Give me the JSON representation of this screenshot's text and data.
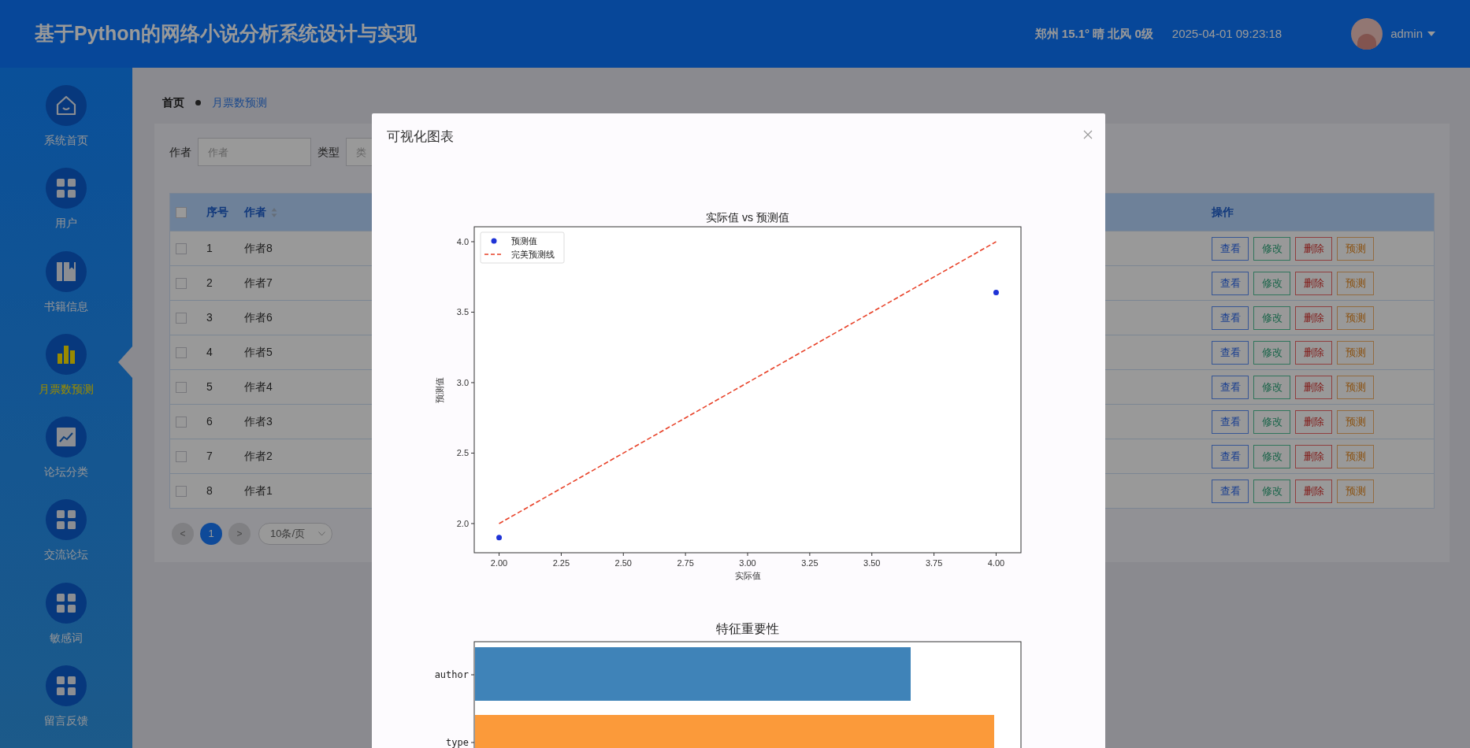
{
  "header": {
    "title": "基于Python的网络小说分析系统设计与实现",
    "weather": "郑州 15.1° 晴 北风 0级",
    "datetime": "2025-04-01 09:23:18",
    "user": "admin"
  },
  "sidebar": {
    "items": [
      {
        "label": "系统首页",
        "selected": false
      },
      {
        "label": "用户",
        "selected": false
      },
      {
        "label": "书籍信息",
        "selected": false
      },
      {
        "label": "月票数预测",
        "selected": true
      },
      {
        "label": "论坛分类",
        "selected": false
      },
      {
        "label": "交流论坛",
        "selected": false
      },
      {
        "label": "敏感词",
        "selected": false
      },
      {
        "label": "留言反馈",
        "selected": false
      }
    ]
  },
  "breadcrumb": [
    "首页",
    "月票数预测"
  ],
  "filters": [
    {
      "label": "作者",
      "placeholder": "作者"
    },
    {
      "label": "类型",
      "placeholder": "类"
    }
  ],
  "table": {
    "select_all_checked": false,
    "columns": [
      {
        "label": "序号",
        "kind": "plain"
      },
      {
        "label": "作者",
        "kind": "sortable"
      },
      {
        "label": "操作",
        "kind": "plain"
      }
    ],
    "rows": [
      {
        "index": "1",
        "author": "作者8",
        "checked": false,
        "actions": [
          {
            "label": "查看",
            "kind": "view"
          },
          {
            "label": "修改",
            "kind": "edit"
          },
          {
            "label": "删除",
            "kind": "delete"
          },
          {
            "label": "预测",
            "kind": "predict"
          }
        ]
      },
      {
        "index": "2",
        "author": "作者7",
        "checked": false,
        "actions": [
          {
            "label": "查看",
            "kind": "view"
          },
          {
            "label": "修改",
            "kind": "edit"
          },
          {
            "label": "删除",
            "kind": "delete"
          },
          {
            "label": "预测",
            "kind": "predict"
          }
        ]
      },
      {
        "index": "3",
        "author": "作者6",
        "checked": false,
        "actions": [
          {
            "label": "查看",
            "kind": "view"
          },
          {
            "label": "修改",
            "kind": "edit"
          },
          {
            "label": "删除",
            "kind": "delete"
          },
          {
            "label": "预测",
            "kind": "predict"
          }
        ]
      },
      {
        "index": "4",
        "author": "作者5",
        "checked": false,
        "actions": [
          {
            "label": "查看",
            "kind": "view"
          },
          {
            "label": "修改",
            "kind": "edit"
          },
          {
            "label": "删除",
            "kind": "delete"
          },
          {
            "label": "预测",
            "kind": "predict"
          }
        ]
      },
      {
        "index": "5",
        "author": "作者4",
        "checked": false,
        "actions": [
          {
            "label": "查看",
            "kind": "view"
          },
          {
            "label": "修改",
            "kind": "edit"
          },
          {
            "label": "删除",
            "kind": "delete"
          },
          {
            "label": "预测",
            "kind": "predict"
          }
        ]
      },
      {
        "index": "6",
        "author": "作者3",
        "checked": false,
        "actions": [
          {
            "label": "查看",
            "kind": "view"
          },
          {
            "label": "修改",
            "kind": "edit"
          },
          {
            "label": "删除",
            "kind": "delete"
          },
          {
            "label": "预测",
            "kind": "predict"
          }
        ]
      },
      {
        "index": "7",
        "author": "作者2",
        "checked": false,
        "actions": [
          {
            "label": "查看",
            "kind": "view"
          },
          {
            "label": "修改",
            "kind": "edit"
          },
          {
            "label": "删除",
            "kind": "delete"
          },
          {
            "label": "预测",
            "kind": "predict"
          }
        ]
      },
      {
        "index": "8",
        "author": "作者1",
        "checked": false,
        "actions": [
          {
            "label": "查看",
            "kind": "view"
          },
          {
            "label": "修改",
            "kind": "edit"
          },
          {
            "label": "删除",
            "kind": "delete"
          },
          {
            "label": "预测",
            "kind": "predict"
          }
        ]
      }
    ]
  },
  "pagination": {
    "prev": "<",
    "next": ">",
    "pages": [
      {
        "label": "1",
        "selected": true
      }
    ],
    "page_size": "10条/页"
  },
  "modal": {
    "title": "可视化图表",
    "chart_data": {
      "type": "scatter",
      "title": "实际值 vs 预测值",
      "xlabel": "实际值",
      "ylabel": "预测值",
      "xlim": [
        1.9,
        4.1
      ],
      "ylim": [
        1.793,
        4.106
      ],
      "xticks": [
        {
          "value": 2,
          "label": "2.00"
        },
        {
          "value": 2.25,
          "label": "2.25"
        },
        {
          "value": 2.5,
          "label": "2.50"
        },
        {
          "value": 2.75,
          "label": "2.75"
        },
        {
          "value": 3,
          "label": "3.00"
        },
        {
          "value": 3.25,
          "label": "3.25"
        },
        {
          "value": 3.5,
          "label": "3.50"
        },
        {
          "value": 3.75,
          "label": "3.75"
        },
        {
          "value": 4,
          "label": "4.00"
        }
      ],
      "yticks": [
        {
          "value": 2,
          "label": "2.0"
        },
        {
          "value": 2.5,
          "label": "2.5"
        },
        {
          "value": 3,
          "label": "3.0"
        },
        {
          "value": 3.5,
          "label": "3.5"
        },
        {
          "value": 4,
          "label": "4.0"
        }
      ],
      "x": [
        2,
        4
      ],
      "series": [
        {
          "name": "预测值",
          "color": "#1f33d6",
          "values": [
            1.9,
            3.64
          ]
        },
        {
          "name": "完美预测线",
          "type": "line",
          "line_style": "dashed",
          "color": "#e8432a",
          "values": [
            2,
            4
          ]
        }
      ],
      "legend": "upper left"
    },
    "feature_chart": {
      "title": "特征重要性",
      "bars": [
        {
          "label": "author",
          "color": "#3f83b8"
        },
        {
          "label": "type",
          "color": "#fb9a3a"
        }
      ]
    }
  }
}
